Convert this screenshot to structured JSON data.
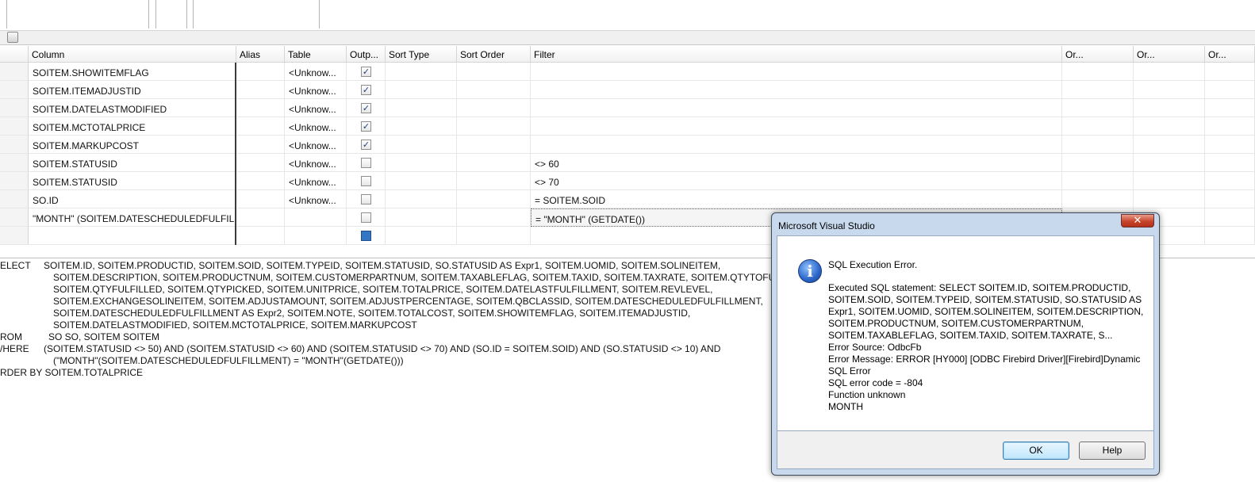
{
  "grid": {
    "headers": {
      "column": "Column",
      "alias": "Alias",
      "table": "Table",
      "output": "Outp...",
      "sort_type": "Sort Type",
      "sort_order": "Sort Order",
      "filter": "Filter",
      "or1": "Or...",
      "or2": "Or...",
      "or3": "Or..."
    },
    "rows": [
      {
        "column": "SOITEM.SHOWITEMFLAG",
        "table": "<Unknow...",
        "output": true,
        "filter": ""
      },
      {
        "column": "SOITEM.ITEMADJUSTID",
        "table": "<Unknow...",
        "output": true,
        "filter": ""
      },
      {
        "column": "SOITEM.DATELASTMODIFIED",
        "table": "<Unknow...",
        "output": true,
        "filter": ""
      },
      {
        "column": "SOITEM.MCTOTALPRICE",
        "table": "<Unknow...",
        "output": true,
        "filter": ""
      },
      {
        "column": "SOITEM.MARKUPCOST",
        "table": "<Unknow...",
        "output": true,
        "filter": ""
      },
      {
        "column": "SOITEM.STATUSID",
        "table": "<Unknow...",
        "output": false,
        "filter": "<> 60"
      },
      {
        "column": "SOITEM.STATUSID",
        "table": "<Unknow...",
        "output": false,
        "filter": "<> 70"
      },
      {
        "column": "SO.ID",
        "table": "<Unknow...",
        "output": false,
        "filter": "= SOITEM.SOID"
      },
      {
        "column": "\"MONTH\" (SOITEM.DATESCHEDULEDFULFILL...",
        "table": "",
        "output": false,
        "filter": "= \"MONTH\" (GETDATE())"
      },
      {
        "column": "",
        "table": "",
        "output": false,
        "filter": ""
      }
    ]
  },
  "sql": {
    "kw_select": "ELECT",
    "kw_from": "ROM",
    "kw_where": "/HERE",
    "kw_order": "RDER BY SOITEM.TOTALPRICE",
    "select_lines": [
      "SOITEM.ID, SOITEM.PRODUCTID, SOITEM.SOID, SOITEM.TYPEID, SOITEM.STATUSID, SO.STATUSID AS Expr1, SOITEM.UOMID, SOITEM.SOLINEITEM,",
      "SOITEM.DESCRIPTION, SOITEM.PRODUCTNUM, SOITEM.CUSTOMERPARTNUM, SOITEM.TAXABLEFLAG, SOITEM.TAXID, SOITEM.TAXRATE, SOITEM.QTYTOFULFILL,",
      "SOITEM.QTYFULFILLED, SOITEM.QTYPICKED, SOITEM.UNITPRICE, SOITEM.TOTALPRICE, SOITEM.DATELASTFULFILLMENT, SOITEM.REVLEVEL,",
      "SOITEM.EXCHANGESOLINEITEM, SOITEM.ADJUSTAMOUNT, SOITEM.ADJUSTPERCENTAGE, SOITEM.QBCLASSID, SOITEM.DATESCHEDULEDFULFILLMENT,",
      "SOITEM.DATESCHEDULEDFULFILLMENT AS Expr2, SOITEM.NOTE, SOITEM.TOTALCOST, SOITEM.SHOWITEMFLAG, SOITEM.ITEMADJUSTID,",
      "SOITEM.DATELASTMODIFIED, SOITEM.MCTOTALPRICE, SOITEM.MARKUPCOST"
    ],
    "from_line": "SO SO, SOITEM SOITEM",
    "where_lines": [
      "(SOITEM.STATUSID <> 50) AND (SOITEM.STATUSID <> 60) AND (SOITEM.STATUSID <> 70) AND (SO.ID = SOITEM.SOID) AND (SO.STATUSID <> 10) AND",
      "(\"MONTH\"(SOITEM.DATESCHEDULEDFULFILLMENT) = \"MONTH\"(GETDATE()))"
    ]
  },
  "dialog": {
    "title": "Microsoft Visual Studio",
    "close_glyph": "✕",
    "icon_glyph": "i",
    "heading": "SQL Execution Error.",
    "message_lines": [
      "Executed SQL statement: SELECT SOITEM.ID, SOITEM.PRODUCTID,",
      "SOITEM.SOID, SOITEM.TYPEID, SOITEM.STATUSID, SO.STATUSID AS",
      "Expr1, SOITEM.UOMID, SOITEM.SOLINEITEM, SOITEM.DESCRIPTION,",
      "SOITEM.PRODUCTNUM, SOITEM.CUSTOMERPARTNUM,",
      "SOITEM.TAXABLEFLAG, SOITEM.TAXID, SOITEM.TAXRATE, S...",
      "Error Source: OdbcFb",
      "Error Message: ERROR [HY000] [ODBC Firebird Driver][Firebird]Dynamic",
      "SQL Error",
      "SQL error code = -804",
      "Function unknown",
      "MONTH"
    ],
    "ok_label": "OK",
    "help_label": "Help"
  }
}
